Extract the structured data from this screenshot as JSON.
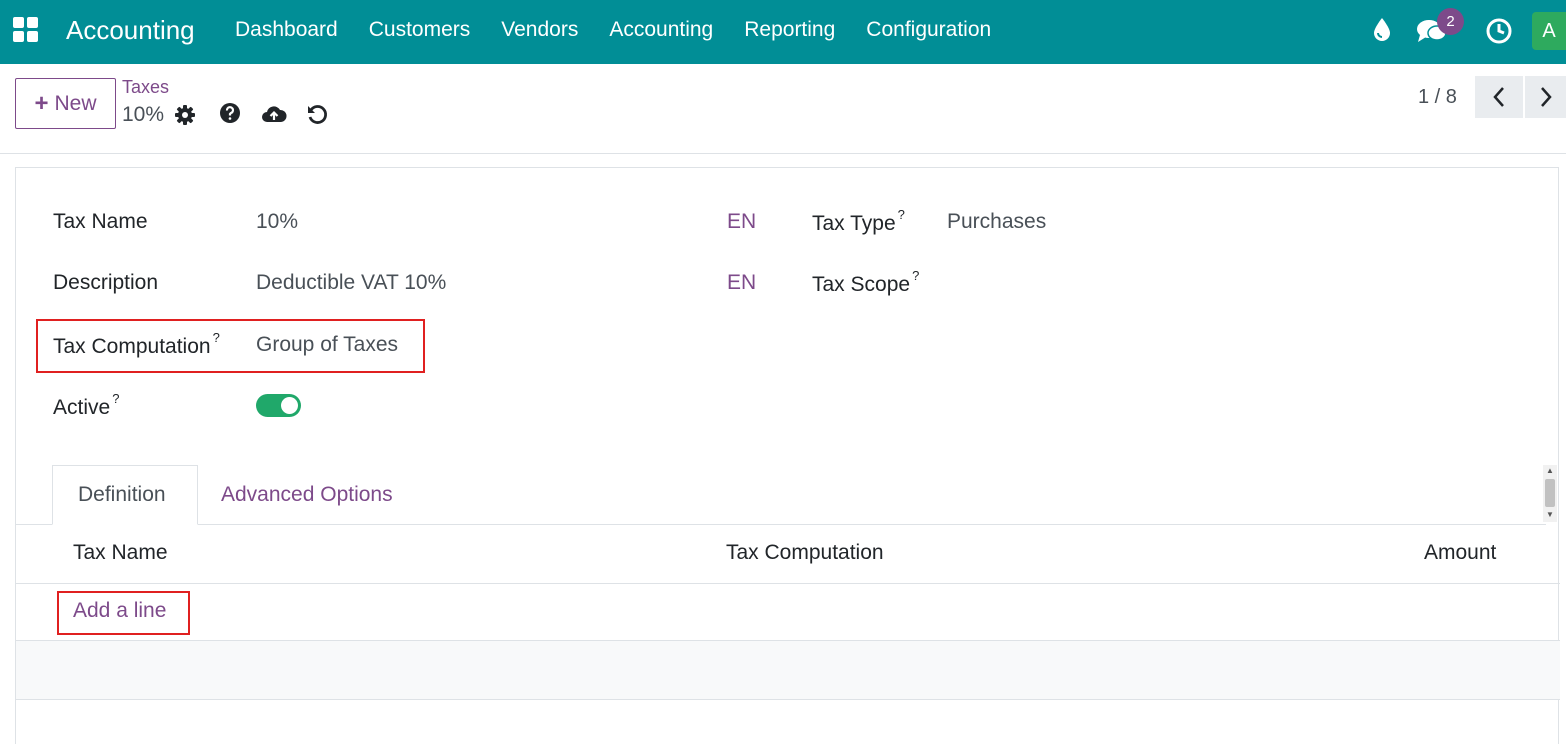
{
  "navbar": {
    "app_name": "Accounting",
    "menu": [
      "Dashboard",
      "Customers",
      "Vendors",
      "Accounting",
      "Reporting",
      "Configuration"
    ],
    "chat_badge": "2",
    "avatar": "A",
    "color": "#018e96"
  },
  "control": {
    "new_label": "New",
    "breadcrumb_parent": "Taxes",
    "breadcrumb_current": "10%",
    "pager": "1 / 8"
  },
  "form": {
    "tax_name_label": "Tax Name",
    "tax_name_value": "10%",
    "description_label": "Description",
    "description_value": "Deductible VAT 10%",
    "tax_computation_label": "Tax Computation",
    "tax_computation_value": "Group of Taxes",
    "active_label": "Active",
    "active_value": true,
    "lang_1": "EN",
    "lang_2": "EN",
    "tax_type_label": "Tax Type",
    "tax_type_value": "Purchases",
    "tax_scope_label": "Tax Scope",
    "help_mark": "?"
  },
  "tabs": [
    "Definition",
    "Advanced Options"
  ],
  "table": {
    "columns": [
      "Tax Name",
      "Tax Computation",
      "Amount"
    ],
    "add_line": "Add a line"
  }
}
